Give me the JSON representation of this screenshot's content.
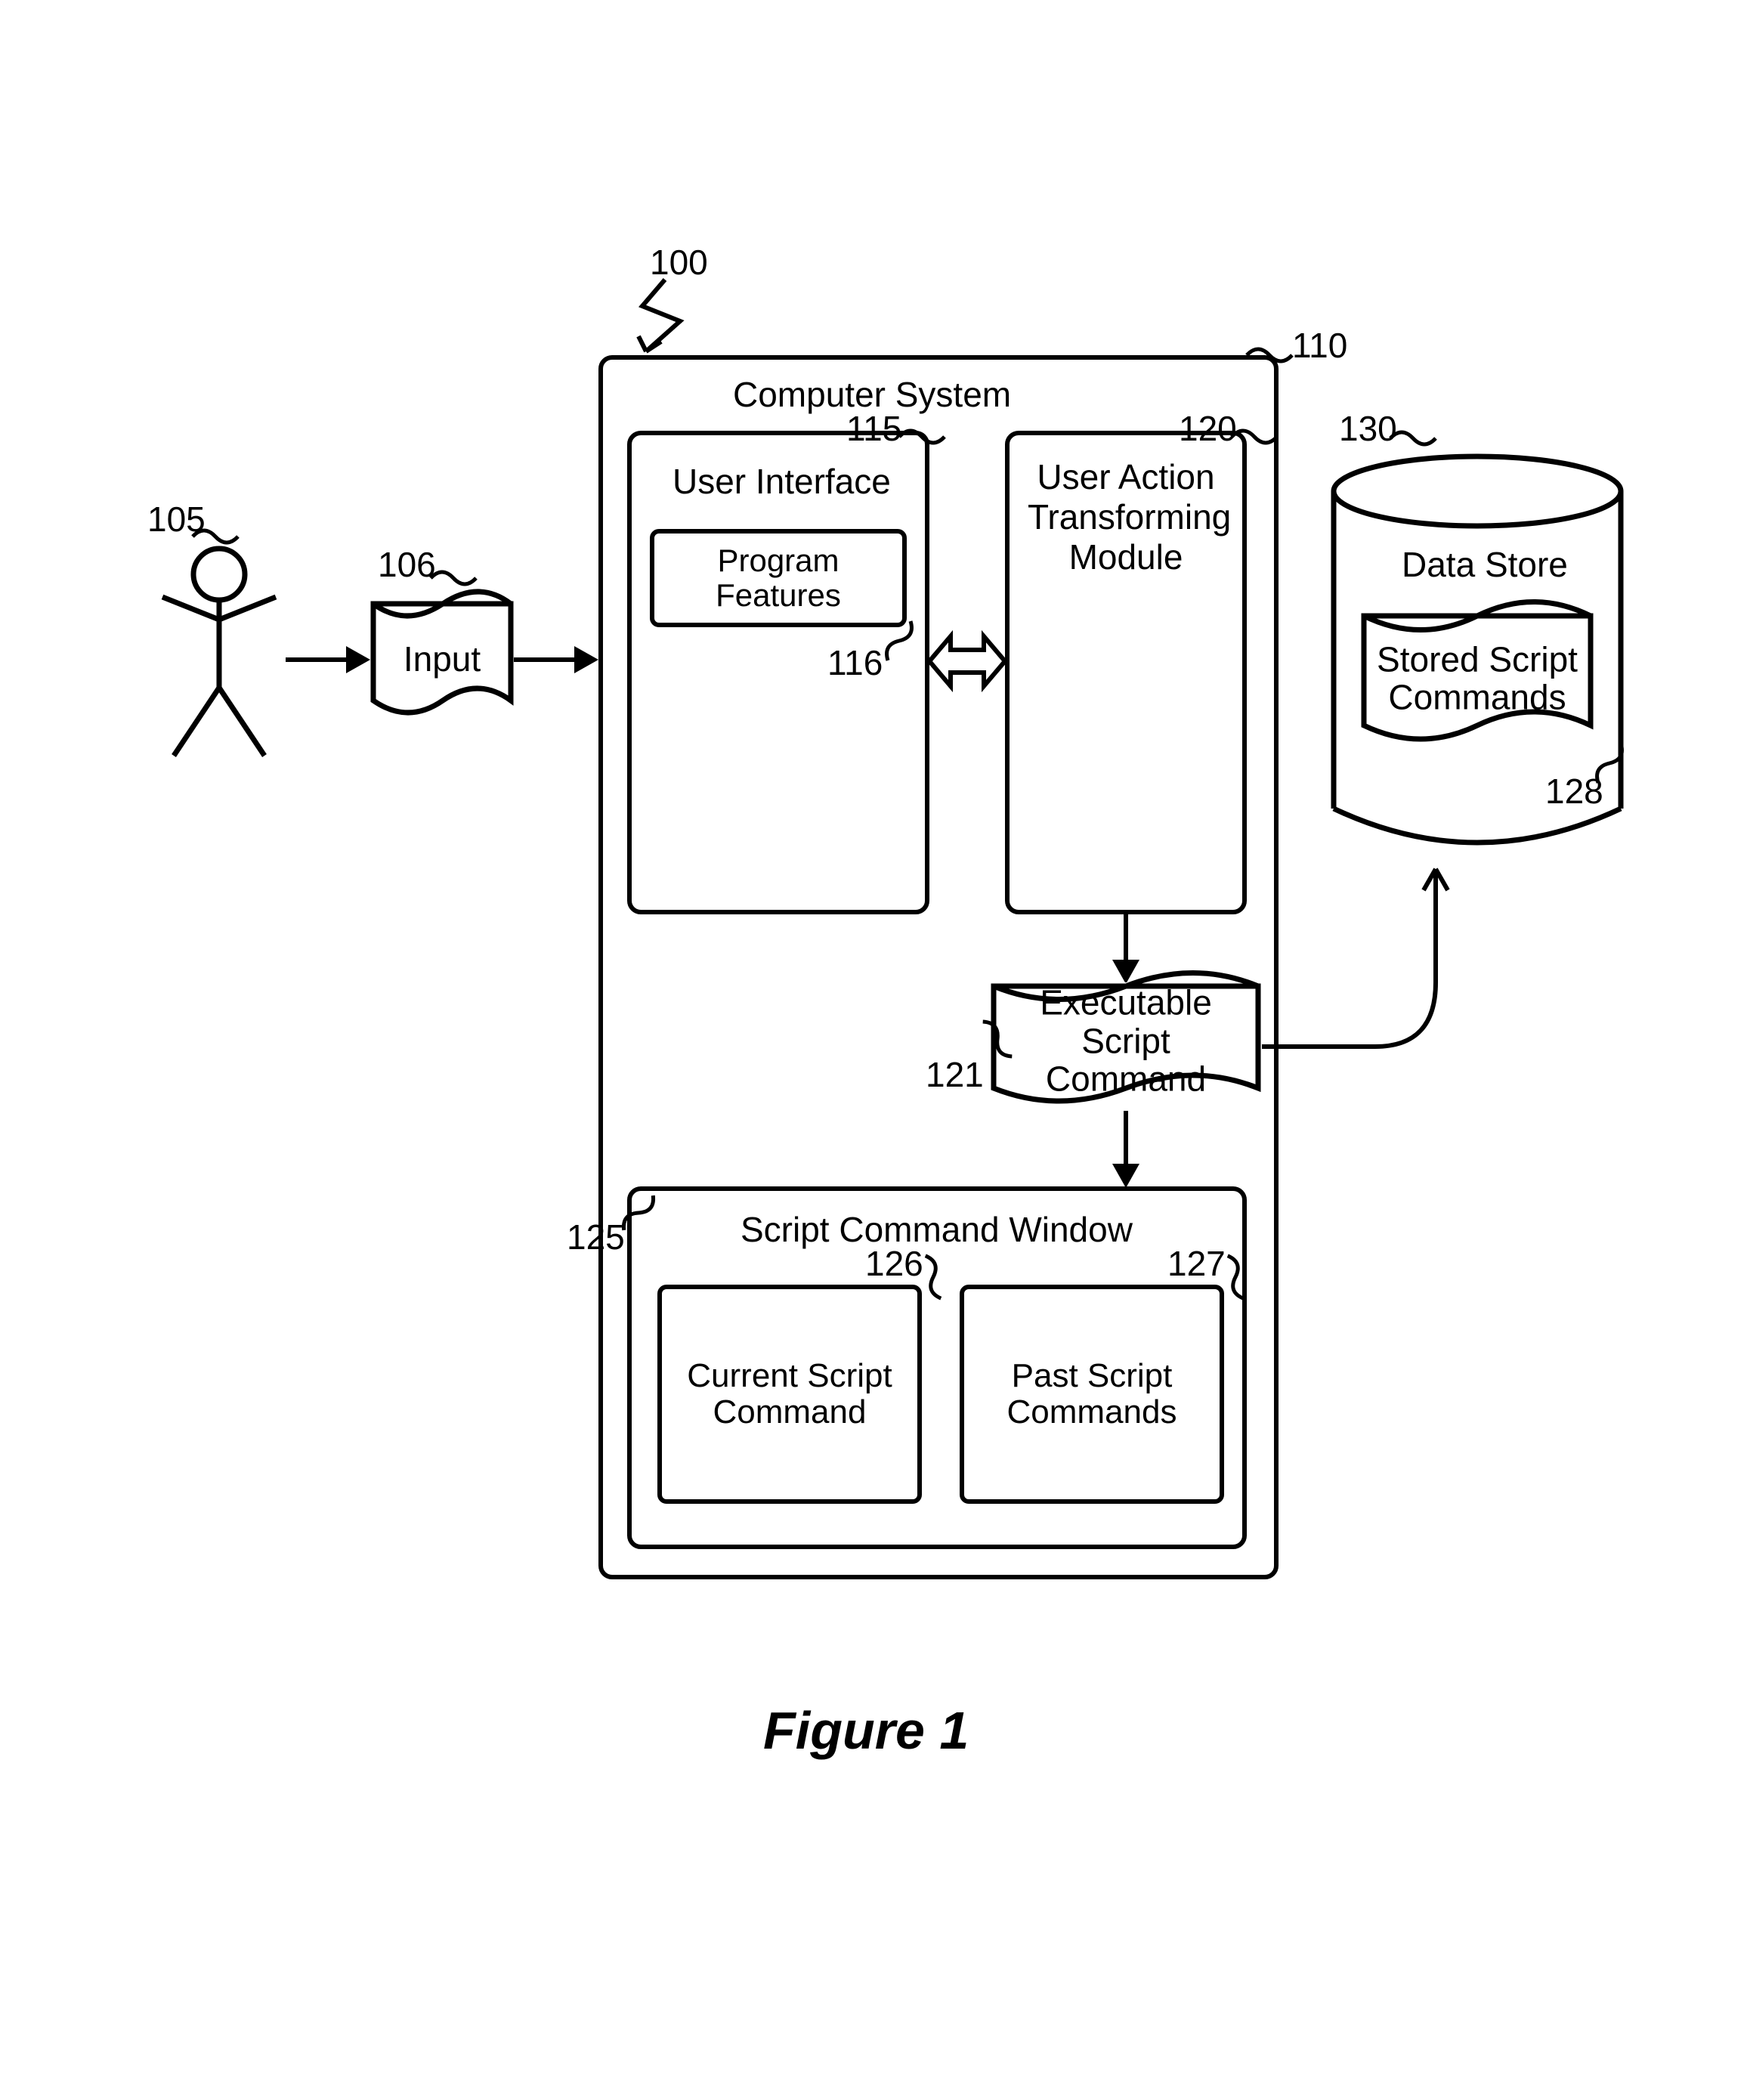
{
  "figure_title": "Figure 1",
  "refs": {
    "overall": "100",
    "user": "105",
    "input": "106",
    "computer_system": "110",
    "user_interface": "115",
    "program_features": "116",
    "transforming_module": "120",
    "exec_script_cmd": "121",
    "script_cmd_window": "125",
    "current_script_cmd": "126",
    "past_script_cmds": "127",
    "stored_script_cmds": "128",
    "data_store": "130"
  },
  "labels": {
    "input": "Input",
    "computer_system": "Computer System",
    "user_interface": "User Interface",
    "program_features": "Program Features",
    "transforming_module": "User Action\nTransforming\nModule",
    "exec_script_cmd": "Executable Script\nCommand",
    "script_cmd_window": "Script Command Window",
    "current_script_cmd": "Current Script\nCommand",
    "past_script_cmds": "Past Script\nCommands",
    "data_store": "Data Store",
    "stored_script_cmds": "Stored Script\nCommands"
  }
}
